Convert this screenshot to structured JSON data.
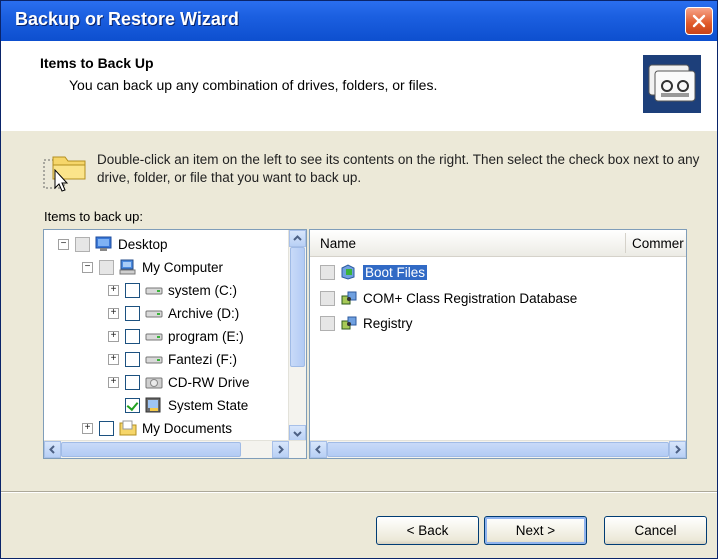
{
  "window": {
    "title": "Backup or Restore Wizard"
  },
  "header": {
    "title": "Items to Back Up",
    "subtitle": "You can back up any combination of drives, folders, or files."
  },
  "hint": {
    "text": "Double-click an item on the left to see its contents on the right. Then select the check box next to any drive, folder, or file that you want to back up."
  },
  "items_label": "Items to back up:",
  "tree": {
    "items": [
      {
        "label": "Desktop",
        "expander": "−",
        "icon": "desktop-icon",
        "checked": false
      },
      {
        "label": "My Computer",
        "expander": "−",
        "icon": "computer-icon",
        "checked": false
      },
      {
        "label": "system (C:)",
        "expander": "+",
        "icon": "drive-icon",
        "checked": false
      },
      {
        "label": "Archive (D:)",
        "expander": "+",
        "icon": "drive-icon",
        "checked": false
      },
      {
        "label": "program (E:)",
        "expander": "+",
        "icon": "drive-icon",
        "checked": false
      },
      {
        "label": "Fantezi (F:)",
        "expander": "+",
        "icon": "drive-icon",
        "checked": false
      },
      {
        "label": "CD-RW Drive",
        "expander": "+",
        "icon": "cd-drive-icon",
        "checked": false
      },
      {
        "label": "System State",
        "expander": "",
        "icon": "system-state-icon",
        "checked": true
      },
      {
        "label": "My Documents",
        "expander": "+",
        "icon": "folder-icon",
        "checked": false
      }
    ]
  },
  "list": {
    "columns": [
      "Name",
      "Commer"
    ],
    "rows": [
      {
        "label": "Boot Files",
        "selected": true
      },
      {
        "label": "COM+ Class Registration Database",
        "selected": false
      },
      {
        "label": "Registry",
        "selected": false
      }
    ]
  },
  "buttons": {
    "back": "< Back",
    "next": "Next >",
    "cancel": "Cancel"
  },
  "colors": {
    "titlebar": "#0d4fcf",
    "selection": "#316ac5",
    "dialog_bg": "#ECE9D8"
  }
}
